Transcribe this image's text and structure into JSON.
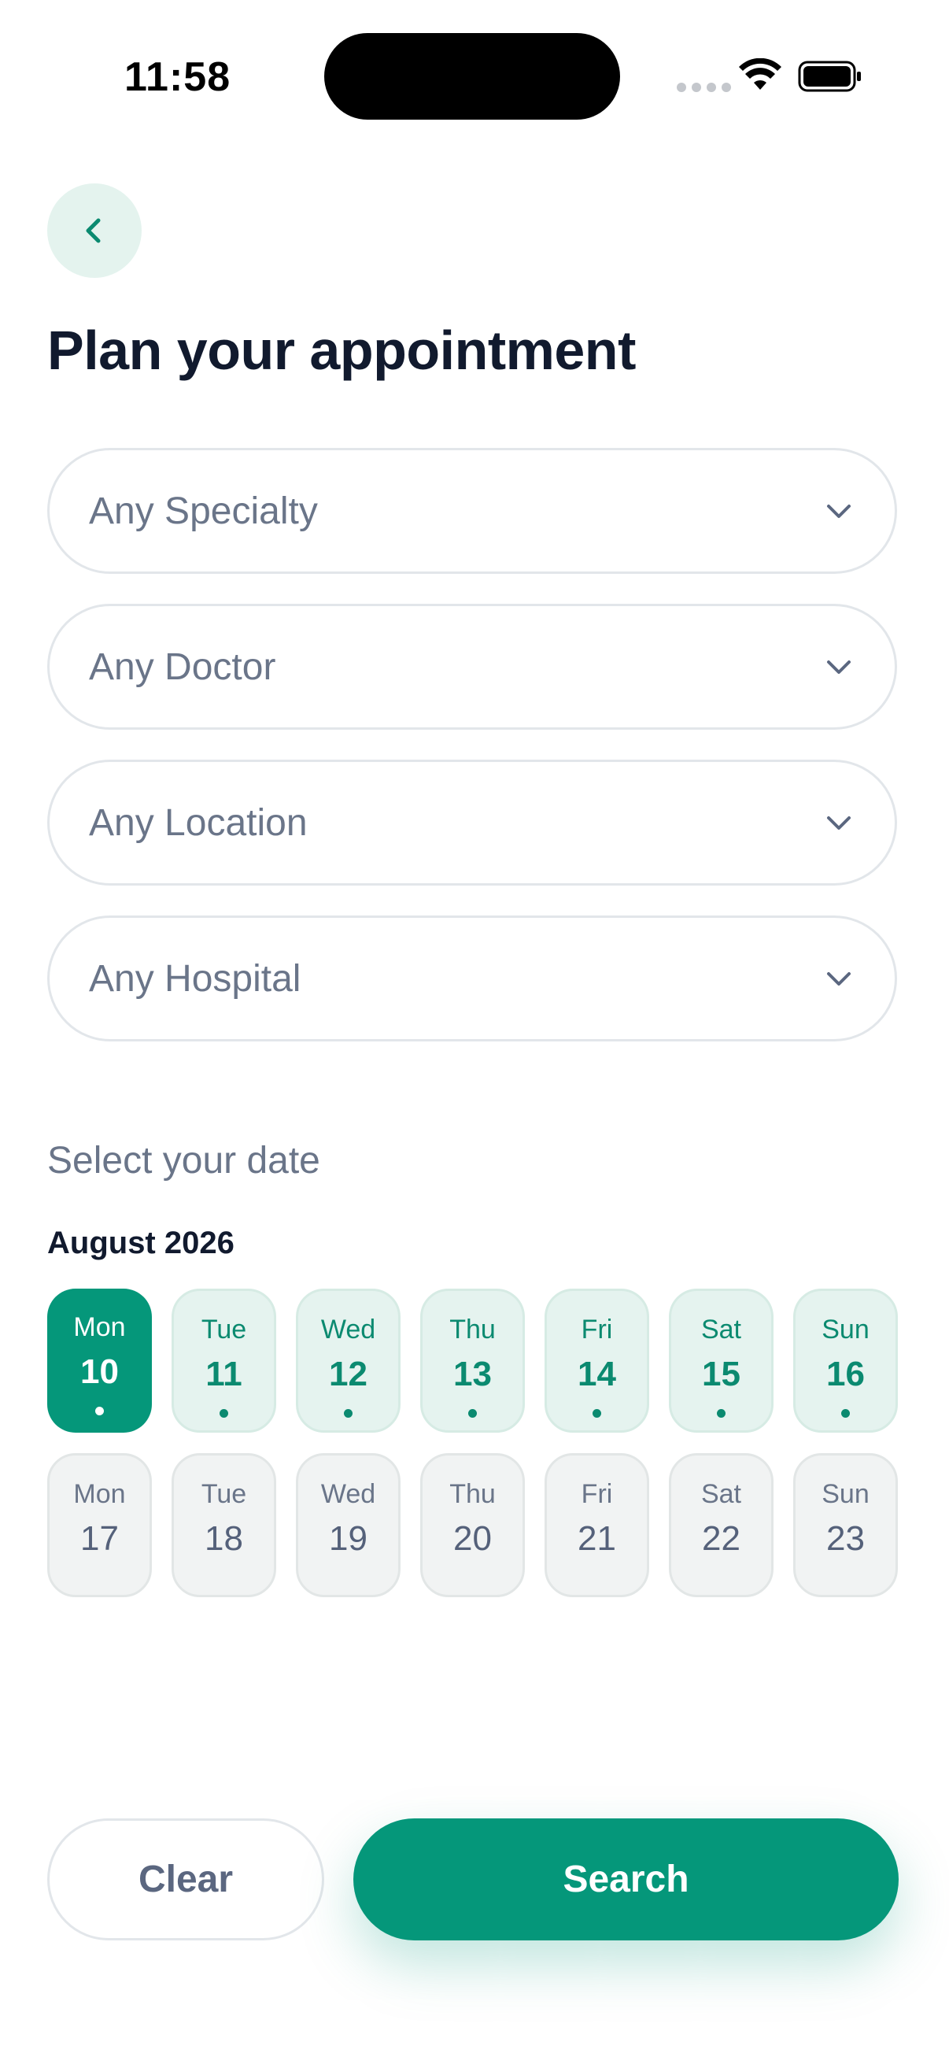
{
  "status_bar": {
    "time": "11:58"
  },
  "header": {
    "back_icon": "chevron-left-icon",
    "title": "Plan your appointment"
  },
  "filters": [
    {
      "label": "Any Specialty"
    },
    {
      "label": "Any Doctor"
    },
    {
      "label": "Any Location"
    },
    {
      "label": "Any Hospital"
    }
  ],
  "date_picker": {
    "section_label": "Select your date",
    "month": "August 2026",
    "week1": [
      {
        "dow": "Mon",
        "day": "10",
        "state": "selected"
      },
      {
        "dow": "Tue",
        "day": "11",
        "state": "available"
      },
      {
        "dow": "Wed",
        "day": "12",
        "state": "available"
      },
      {
        "dow": "Thu",
        "day": "13",
        "state": "available"
      },
      {
        "dow": "Fri",
        "day": "14",
        "state": "available"
      },
      {
        "dow": "Sat",
        "day": "15",
        "state": "available"
      },
      {
        "dow": "Sun",
        "day": "16",
        "state": "available"
      }
    ],
    "week2": [
      {
        "dow": "Mon",
        "day": "17",
        "state": "unavailable"
      },
      {
        "dow": "Tue",
        "day": "18",
        "state": "unavailable"
      },
      {
        "dow": "Wed",
        "day": "19",
        "state": "unavailable"
      },
      {
        "dow": "Thu",
        "day": "20",
        "state": "unavailable"
      },
      {
        "dow": "Fri",
        "day": "21",
        "state": "unavailable"
      },
      {
        "dow": "Sat",
        "day": "22",
        "state": "unavailable"
      },
      {
        "dow": "Sun",
        "day": "23",
        "state": "unavailable"
      }
    ]
  },
  "actions": {
    "clear_label": "Clear",
    "search_label": "Search"
  },
  "colors": {
    "accent": "#05977a",
    "accent_light": "#e5f3ef",
    "text_primary": "#111a2e",
    "text_muted": "#6a7589"
  }
}
